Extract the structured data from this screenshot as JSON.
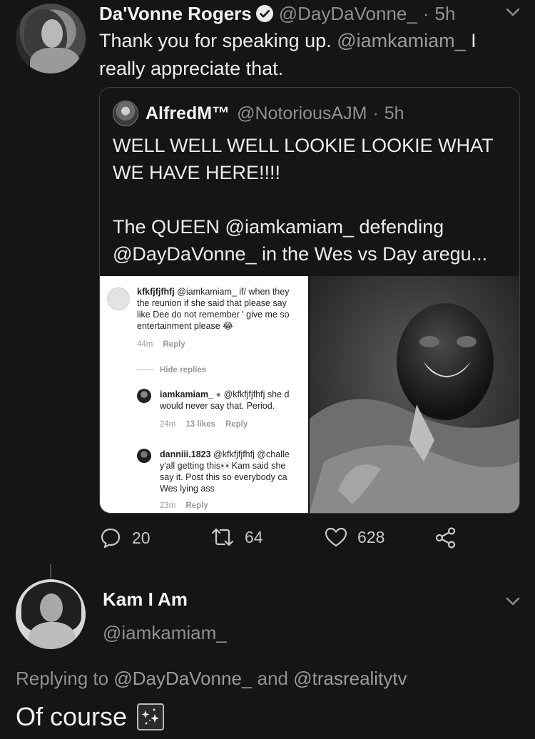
{
  "tweet": {
    "author_name": "Da'Vonne Rogers",
    "author_handle": "@DayDaVonne_",
    "separator": "·",
    "time": "5h",
    "text_before": "Thank you for speaking up. ",
    "mention": "@iamkamiam_",
    "text_after": " I really appreciate that.",
    "icons": {
      "verified": "verified-badge-icon",
      "caret": "chevron-down-icon"
    }
  },
  "quote": {
    "author_name": "AlfredM™",
    "author_handle": "@NotoriousAJM",
    "separator": "·",
    "time": "5h",
    "line1": "WELL WELL WELL LOOKIE LOOKIE WHAT WE HAVE HERE!!!!",
    "line2": "The QUEEN @iamkamiam_ defending @DayDaVonne_ in the Wes vs Day aregu...",
    "screenshot": {
      "c1_user": "kfkfjfjfhfj",
      "c1_text1": "@iamkamiam_  if/ when they",
      "c1_text2": "the reunion if she said that please say",
      "c1_text3": "like Dee do not remember ' give me so",
      "c1_text4": "entertainment please 😂",
      "c1_time": "44m",
      "c1_reply": "Reply",
      "hide_replies": "Hide replies",
      "c2_user": "iamkamiam_",
      "c2_text1": "@kfkfjfjfhfj she d",
      "c2_text2": "would never say that. Period.",
      "c2_time": "24m",
      "c2_likes": "13 likes",
      "c2_reply": "Reply",
      "c3_user": "danniii.1823",
      "c3_text1": "@kfkfjfjfhfj @challe",
      "c3_text2": "y'all getting this👀Kam said she",
      "c3_text3": "say it. Post this so everybody ca",
      "c3_text4": "Wes lying ass",
      "c3_time": "23m",
      "c3_reply": "Reply"
    }
  },
  "actions": {
    "replies": "20",
    "retweets": "64",
    "likes": "628",
    "icons": [
      "reply-icon",
      "retweet-icon",
      "like-icon",
      "share-icon"
    ]
  },
  "reply": {
    "author_name": "Kam I Am",
    "author_handle": "@iamkamiam_",
    "replying_prefix": "Replying to ",
    "replying_user1": "@DayDaVonne_",
    "replying_and": " and ",
    "replying_user2": "@trasrealitytv",
    "text": "Of course",
    "emoji": "sparkles-emoji"
  },
  "colors": {
    "background": "#151515",
    "text": "#ececec",
    "muted": "#8f8f8f",
    "border": "#3e3e3e"
  }
}
